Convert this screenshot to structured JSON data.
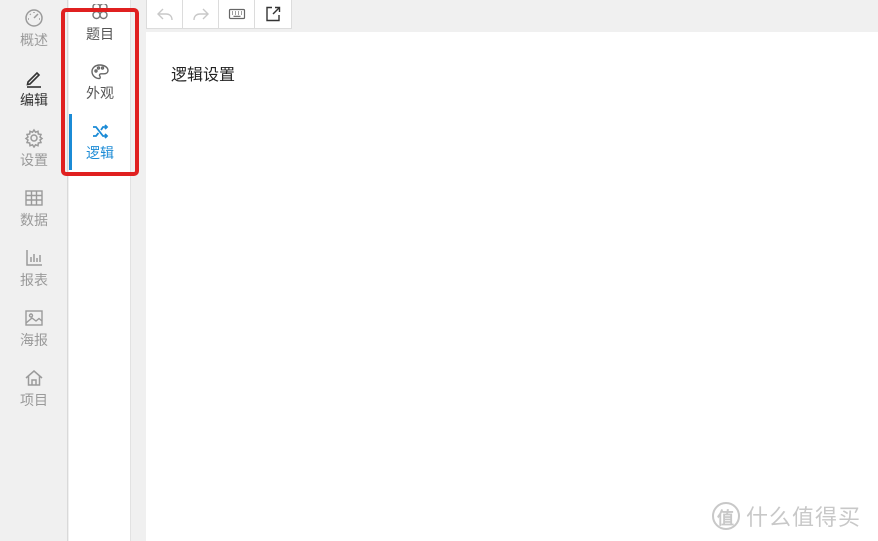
{
  "main_nav": {
    "items": [
      {
        "label": "概述",
        "icon": "dashboard-icon"
      },
      {
        "label": "编辑",
        "icon": "pencil-icon",
        "active": true
      },
      {
        "label": "设置",
        "icon": "gear-icon"
      },
      {
        "label": "数据",
        "icon": "table-icon"
      },
      {
        "label": "报表",
        "icon": "bar-chart-icon"
      },
      {
        "label": "海报",
        "icon": "image-icon"
      },
      {
        "label": "项目",
        "icon": "home-icon"
      }
    ]
  },
  "sub_nav": {
    "items": [
      {
        "label": "题目",
        "icon": "question-icon"
      },
      {
        "label": "外观",
        "icon": "palette-icon"
      },
      {
        "label": "逻辑",
        "icon": "shuffle-icon",
        "active": true
      }
    ]
  },
  "toolbar": {
    "buttons": [
      "undo-icon",
      "redo-icon",
      "keyboard-icon",
      "preview-icon"
    ]
  },
  "main": {
    "title": "逻辑设置"
  },
  "watermark": {
    "logo_char": "值",
    "text": "什么值得买"
  },
  "colors": {
    "accent": "#1b8bd6",
    "highlight": "#e02020"
  }
}
